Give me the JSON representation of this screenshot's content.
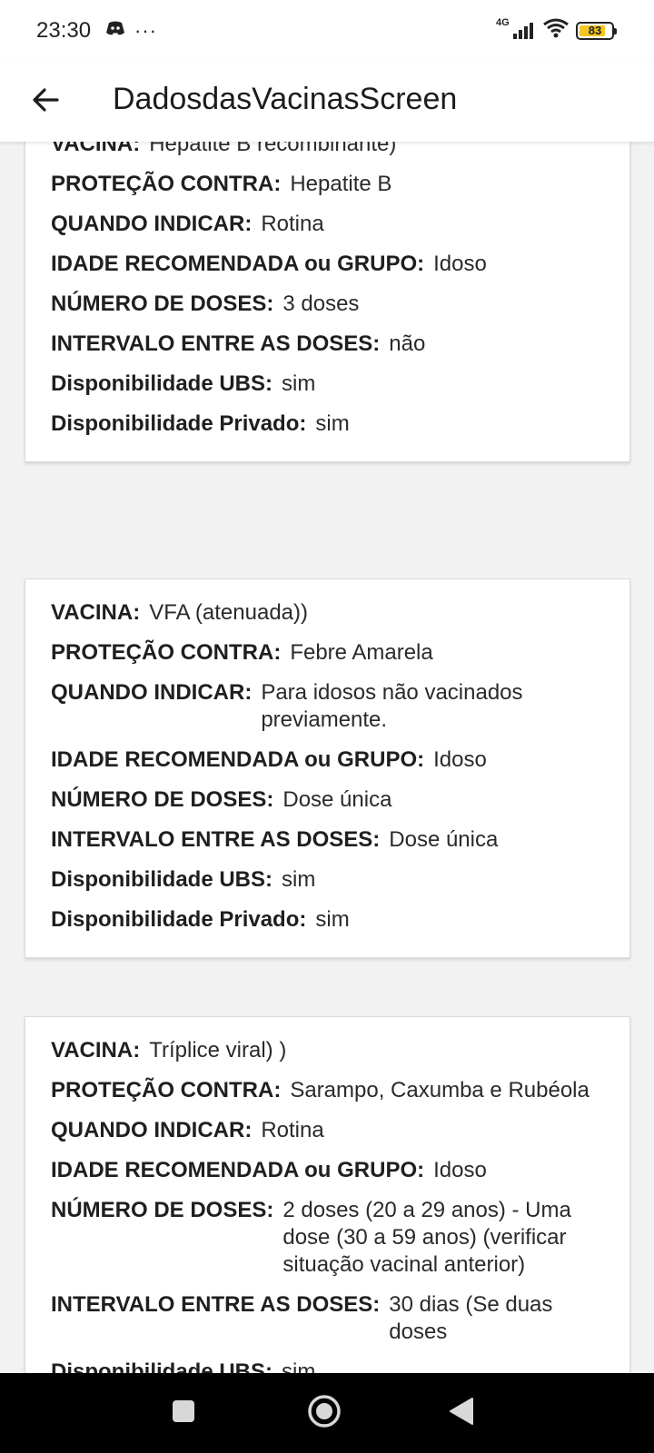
{
  "status_bar": {
    "time": "23:30",
    "notification_icons": [
      "discord-icon"
    ],
    "overflow_dots": "···",
    "network": "4G",
    "battery_percent": 83,
    "battery_label": "83",
    "battery_color": "#f3c623"
  },
  "app_bar": {
    "back_icon": "arrow-left-icon",
    "title": "DadosdasVacinasScreen"
  },
  "cards": [
    {
      "fields": [
        {
          "label": "VACINA:",
          "value": "Hepatite B recombinante)"
        },
        {
          "label": "PROTEÇÃO CONTRA:",
          "value": "Hepatite B"
        },
        {
          "label": "QUANDO INDICAR:",
          "value": "Rotina"
        },
        {
          "label": "IDADE RECOMENDADA ou GRUPO:",
          "value": "Idoso"
        },
        {
          "label": "NÚMERO DE DOSES:",
          "value": "3 doses"
        },
        {
          "label": "INTERVALO ENTRE AS DOSES:",
          "value": "não"
        },
        {
          "label": "Disponibilidade UBS:",
          "value": "sim"
        },
        {
          "label": "Disponibilidade Privado:",
          "value": "sim"
        }
      ]
    },
    {
      "fields": [
        {
          "label": "VACINA:",
          "value": "VFA (atenuada))"
        },
        {
          "label": "PROTEÇÃO CONTRA:",
          "value": "Febre Amarela"
        },
        {
          "label": "QUANDO INDICAR:",
          "value": "Para idosos não vacinados previamente."
        },
        {
          "label": "IDADE RECOMENDADA ou GRUPO:",
          "value": "Idoso"
        },
        {
          "label": "NÚMERO DE DOSES:",
          "value": "Dose única"
        },
        {
          "label": "INTERVALO ENTRE AS DOSES:",
          "value": "Dose única"
        },
        {
          "label": "Disponibilidade UBS:",
          "value": "sim"
        },
        {
          "label": "Disponibilidade Privado:",
          "value": "sim"
        }
      ]
    },
    {
      "fields": [
        {
          "label": "VACINA:",
          "value": "Tríplice viral) )"
        },
        {
          "label": "PROTEÇÃO CONTRA:",
          "value": "Sarampo, Caxumba e Rubéola"
        },
        {
          "label": "QUANDO INDICAR:",
          "value": "Rotina"
        },
        {
          "label": "IDADE RECOMENDADA ou GRUPO:",
          "value": "Idoso"
        },
        {
          "label": "NÚMERO DE DOSES:",
          "value": "2 doses (20 a 29 anos) - Uma dose (30 a 59 anos) (verificar situação vacinal anterior)"
        },
        {
          "label": "INTERVALO ENTRE AS DOSES:",
          "value": "30 dias (Se duas doses"
        },
        {
          "label": "Disponibilidade UBS:",
          "value": "sim"
        }
      ]
    }
  ],
  "nav_bar": {
    "icons": [
      "recent-apps-square-icon",
      "home-circle-icon",
      "back-triangle-icon"
    ]
  }
}
